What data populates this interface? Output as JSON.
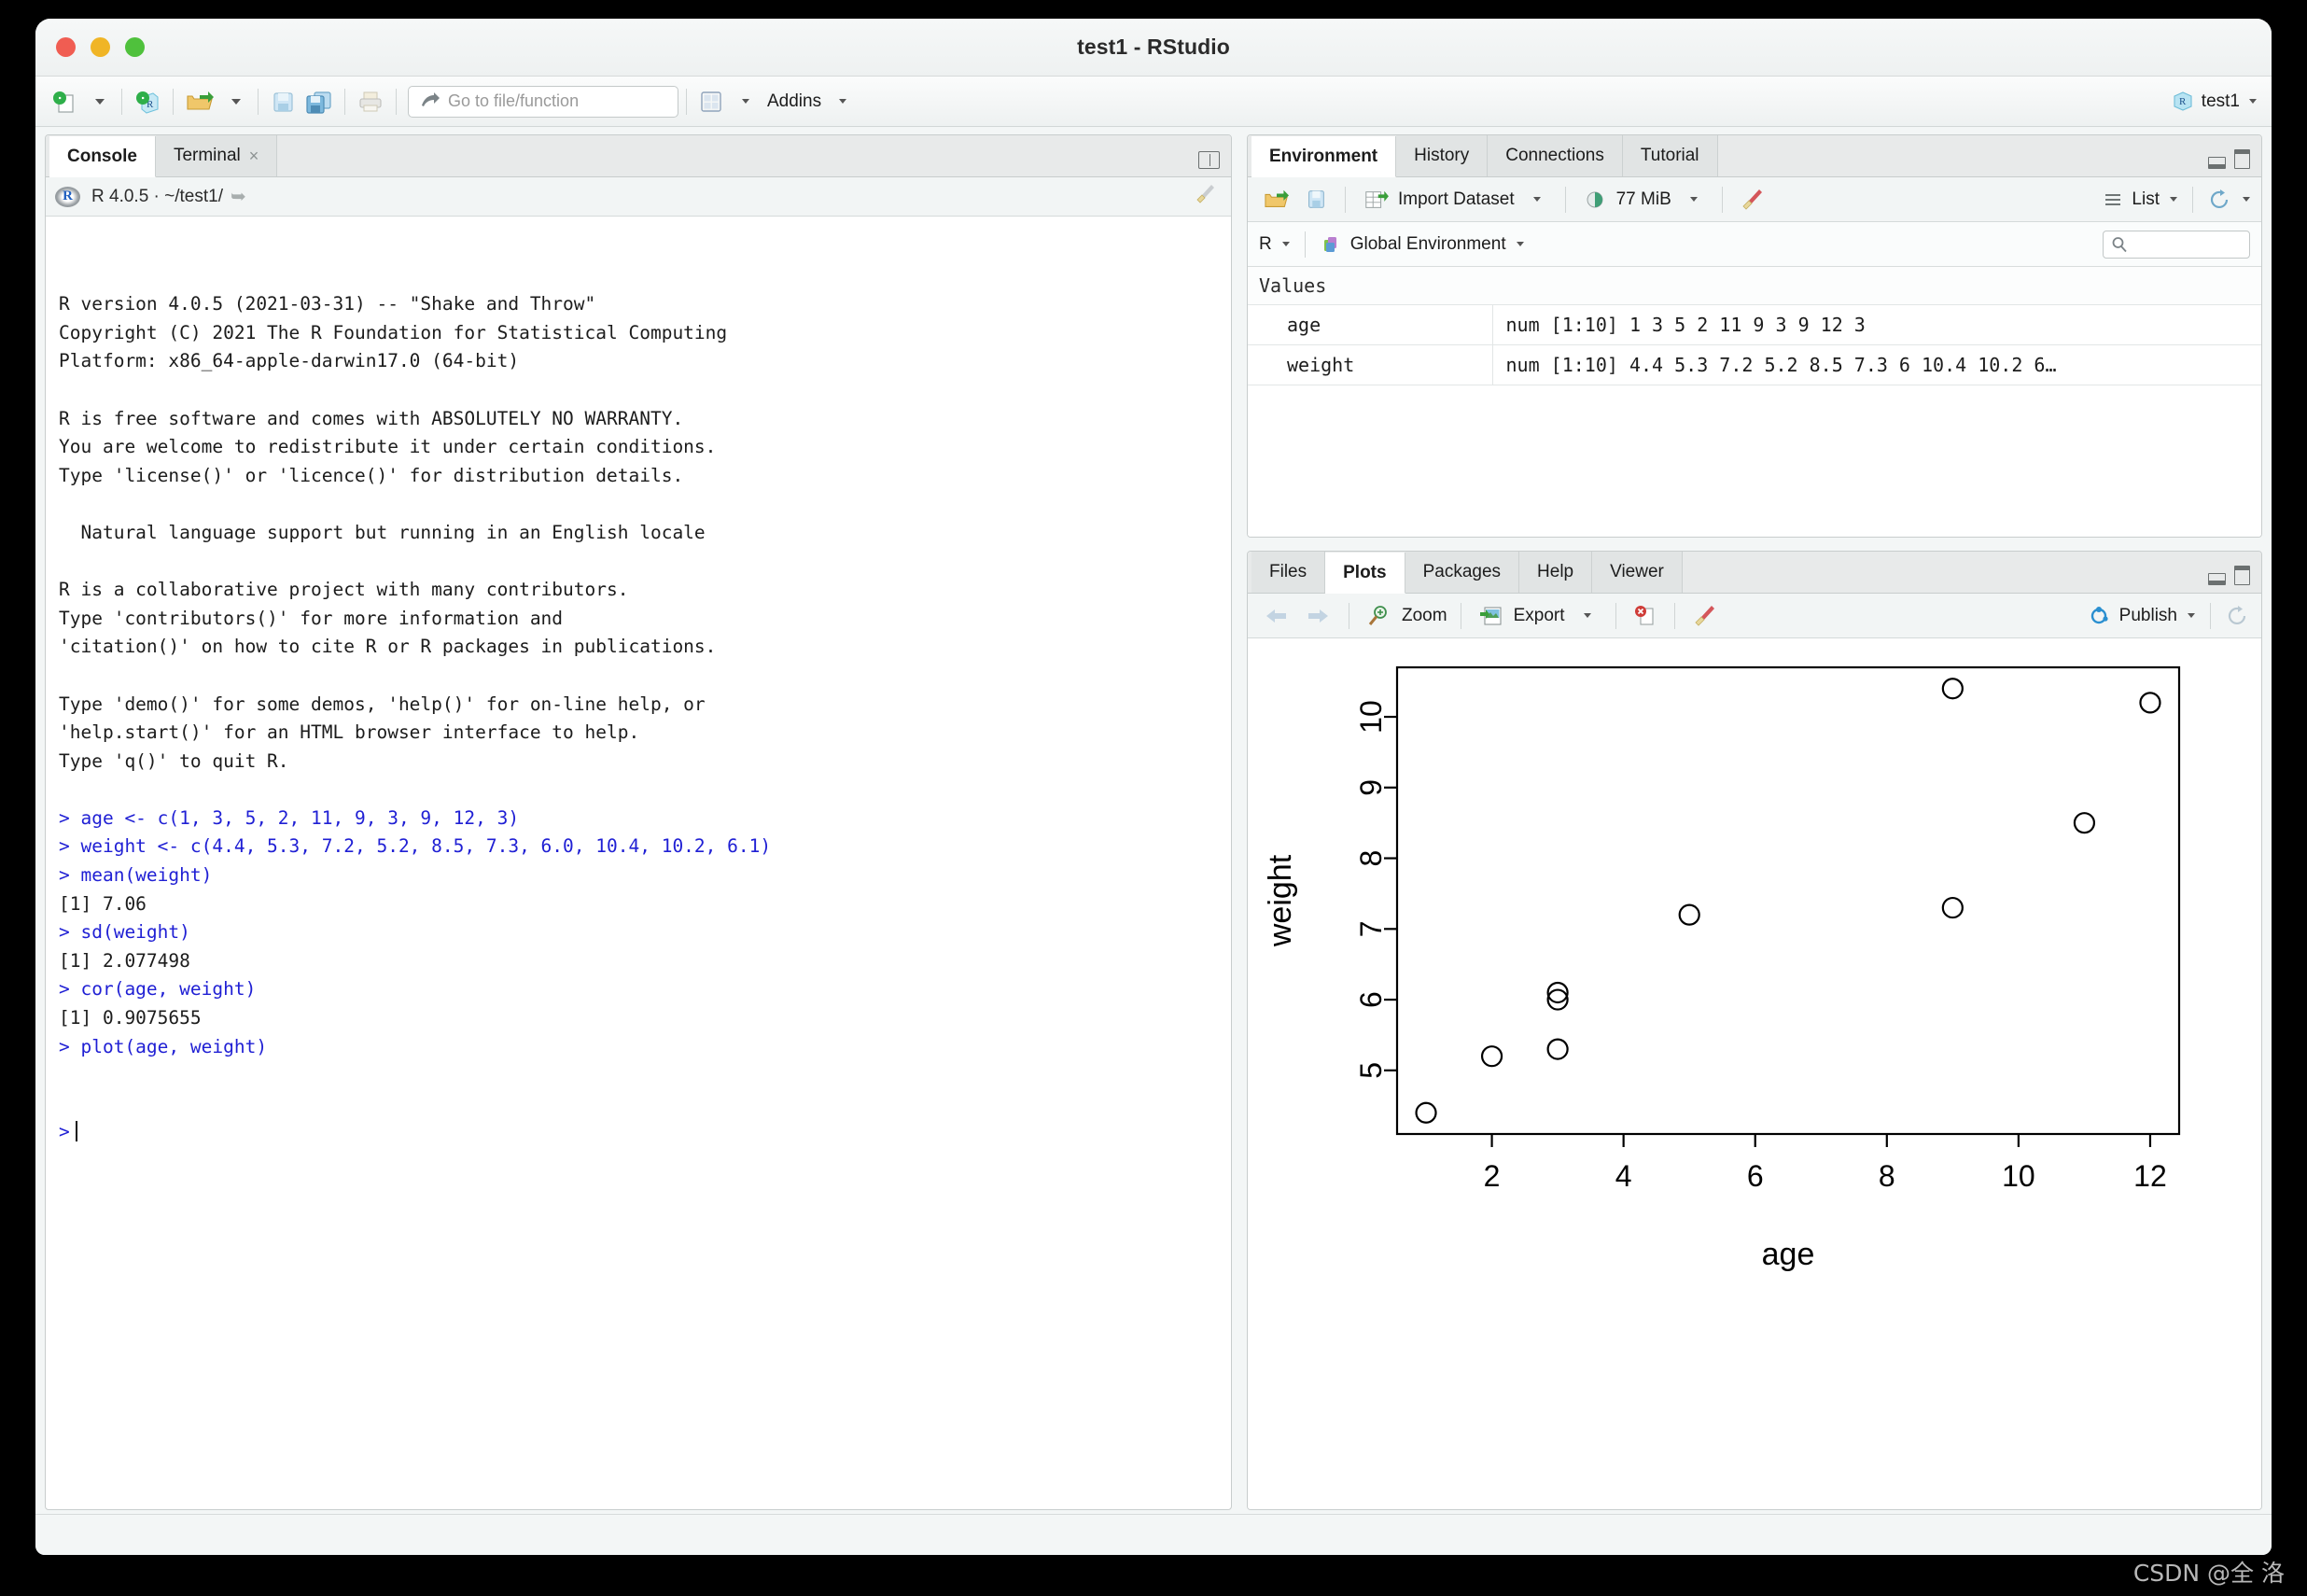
{
  "window": {
    "title": "test1 - RStudio",
    "traffic_lights": [
      "close",
      "minimize",
      "maximize"
    ]
  },
  "toolbar": {
    "new_file_label": "new-file",
    "new_project_label": "new-project",
    "open_file_label": "open-file",
    "save_label": "save",
    "save_all_label": "save-all",
    "print_label": "print",
    "goto_placeholder": "Go to file/function",
    "panes_label": "workspace-panes",
    "addins_label": "Addins",
    "project_name": "test1"
  },
  "console_pane": {
    "tabs": [
      {
        "label": "Console",
        "active": true,
        "closable": false
      },
      {
        "label": "Terminal",
        "active": false,
        "closable": true,
        "close_glyph": "×"
      }
    ],
    "header": {
      "r_logo": "R",
      "version_path": "R 4.0.5 · ~/test1/",
      "share_icon": "share-arrow-icon",
      "broom_icon": "broom-icon"
    },
    "lines": [
      {
        "text": "R version 4.0.5 (2021-03-31) -- \"Shake and Throw\"",
        "type": "out"
      },
      {
        "text": "Copyright (C) 2021 The R Foundation for Statistical Computing",
        "type": "out"
      },
      {
        "text": "Platform: x86_64-apple-darwin17.0 (64-bit)",
        "type": "out"
      },
      {
        "text": "",
        "type": "out"
      },
      {
        "text": "R is free software and comes with ABSOLUTELY NO WARRANTY.",
        "type": "out"
      },
      {
        "text": "You are welcome to redistribute it under certain conditions.",
        "type": "out"
      },
      {
        "text": "Type 'license()' or 'licence()' for distribution details.",
        "type": "out"
      },
      {
        "text": "",
        "type": "out"
      },
      {
        "text": "  Natural language support but running in an English locale",
        "type": "out"
      },
      {
        "text": "",
        "type": "out"
      },
      {
        "text": "R is a collaborative project with many contributors.",
        "type": "out"
      },
      {
        "text": "Type 'contributors()' for more information and",
        "type": "out"
      },
      {
        "text": "'citation()' on how to cite R or R packages in publications.",
        "type": "out"
      },
      {
        "text": "",
        "type": "out"
      },
      {
        "text": "Type 'demo()' for some demos, 'help()' for on-line help, or",
        "type": "out"
      },
      {
        "text": "'help.start()' for an HTML browser interface to help.",
        "type": "out"
      },
      {
        "text": "Type 'q()' to quit R.",
        "type": "out"
      },
      {
        "text": "",
        "type": "out"
      },
      {
        "text": "> age <- c(1, 3, 5, 2, 11, 9, 3, 9, 12, 3)",
        "type": "cmd"
      },
      {
        "text": "> weight <- c(4.4, 5.3, 7.2, 5.2, 8.5, 7.3, 6.0, 10.4, 10.2, 6.1)",
        "type": "cmd"
      },
      {
        "text": "> mean(weight)",
        "type": "cmd"
      },
      {
        "text": "[1] 7.06",
        "type": "out"
      },
      {
        "text": "> sd(weight)",
        "type": "cmd"
      },
      {
        "text": "[1] 2.077498",
        "type": "out"
      },
      {
        "text": "> cor(age, weight)",
        "type": "cmd"
      },
      {
        "text": "[1] 0.9075655",
        "type": "out"
      },
      {
        "text": "> plot(age, weight)",
        "type": "cmd"
      }
    ],
    "prompt": ">"
  },
  "environment_pane": {
    "tabs": [
      {
        "label": "Environment",
        "active": true
      },
      {
        "label": "History",
        "active": false
      },
      {
        "label": "Connections",
        "active": false
      },
      {
        "label": "Tutorial",
        "active": false
      }
    ],
    "toolbar": {
      "load_icon": "open-folder-icon",
      "save_icon": "save-disk-icon",
      "import_label": "Import Dataset",
      "memory_label": "77 MiB",
      "broom_icon": "broom-icon",
      "view_mode_label": "List",
      "refresh_icon": "refresh-icon"
    },
    "scope": {
      "language_label": "R",
      "environment_label": "Global Environment",
      "search_placeholder": ""
    },
    "section_label": "Values",
    "variables": [
      {
        "name": "age",
        "value": "num [1:10] 1 3 5 2 11 9 3 9 12 3"
      },
      {
        "name": "weight",
        "value": "num [1:10] 4.4 5.3 7.2 5.2 8.5 7.3 6 10.4 10.2 6…"
      }
    ]
  },
  "plot_pane": {
    "tabs": [
      {
        "label": "Files",
        "active": false
      },
      {
        "label": "Plots",
        "active": true
      },
      {
        "label": "Packages",
        "active": false
      },
      {
        "label": "Help",
        "active": false
      },
      {
        "label": "Viewer",
        "active": false
      }
    ],
    "toolbar": {
      "back_icon": "arrow-left-icon",
      "forward_icon": "arrow-right-icon",
      "zoom_label": "Zoom",
      "export_label": "Export",
      "remove_icon": "remove-plot-icon",
      "clear_icon": "broom-icon",
      "publish_label": "Publish",
      "refresh_icon": "refresh-icon"
    }
  },
  "chart_data": {
    "type": "scatter",
    "title": "",
    "xlabel": "age",
    "ylabel": "weight",
    "xlim": [
      0.56,
      12.44
    ],
    "ylim": [
      4.1,
      10.7
    ],
    "xticks": [
      2,
      4,
      6,
      8,
      10,
      12
    ],
    "yticks": [
      5,
      6,
      7,
      8,
      9,
      10
    ],
    "grid": false,
    "legend": null,
    "marker": "open-circle",
    "x": [
      1,
      3,
      5,
      2,
      11,
      9,
      3,
      9,
      12,
      3
    ],
    "y": [
      4.4,
      5.3,
      7.2,
      5.2,
      8.5,
      7.3,
      6.0,
      10.4,
      10.2,
      6.1
    ],
    "points": [
      {
        "x": 1,
        "y": 4.4
      },
      {
        "x": 3,
        "y": 5.3
      },
      {
        "x": 5,
        "y": 7.2
      },
      {
        "x": 2,
        "y": 5.2
      },
      {
        "x": 11,
        "y": 8.5
      },
      {
        "x": 9,
        "y": 7.3
      },
      {
        "x": 3,
        "y": 6.0
      },
      {
        "x": 9,
        "y": 10.4
      },
      {
        "x": 12,
        "y": 10.2
      },
      {
        "x": 3,
        "y": 6.1
      }
    ]
  },
  "watermark": "CSDN @全 洛"
}
